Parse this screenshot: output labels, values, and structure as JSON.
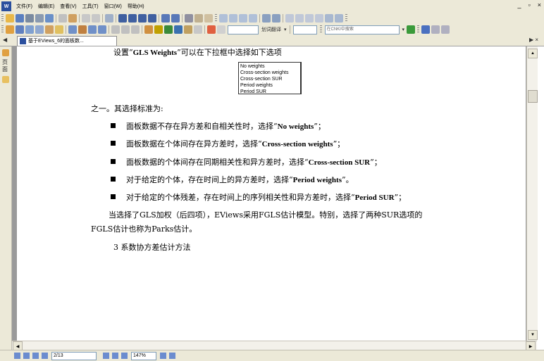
{
  "menubar": {
    "app_icon": "W",
    "items": [
      "文件(F)",
      "编辑(E)",
      "查看(V)",
      "工具(T)",
      "窗口(W)",
      "帮助(H)"
    ],
    "controls": [
      "_",
      "▫",
      "×"
    ]
  },
  "toolbar2": {
    "zoom_select": "划词翻译",
    "search_placeholder": "在CNKI中搜索"
  },
  "tab": {
    "title": "基于EViews_6的面板数...",
    "nav_left": "◀",
    "nav_right": "▶ ×"
  },
  "left_panel": {
    "label": "页面"
  },
  "document": {
    "line1_prefix": "设置“",
    "line1_bold": "GLS Weights",
    "line1_suffix": "”可以在下拉框中选择如下选项",
    "listbox_options": [
      "No weights",
      "Cross-section weights",
      "Cross-section SUR",
      "Period weights",
      "Period SUR"
    ],
    "para1": "之一。其选择标准为:",
    "bullets": [
      {
        "text": "面板数据不存在异方差和自相关性时，选择“",
        "bold": "No weights",
        "tail": "”；"
      },
      {
        "text": "面板数据在个体间存在异方差时，选择“",
        "bold": "Cross-section weights",
        "tail": "”；"
      },
      {
        "text": "面板数据的个体间存在同期相关性和异方差时，选择“",
        "bold": "Cross-section SUR",
        "tail": "”；"
      },
      {
        "text": "对于给定的个体，存在时间上的异方差时，选择“",
        "bold": "Period weights",
        "tail": "”。"
      },
      {
        "text": "对于给定的个体残差，存在时间上的序列相关性和异方差时，选择“",
        "bold": "Period SUR",
        "tail": "”；"
      }
    ],
    "para2_line1": "当选择了GLS加权（后四项），EViews采用FGLS估计模型。特别，选择了两种SUR选项的",
    "para2_line2": "FGLS估计也称为Parks估计。",
    "section_heading": "3  系数协方差估计方法"
  },
  "status": {
    "page": "2/13",
    "zoom": "147%"
  },
  "colors": {
    "chrome": "#ece9d8",
    "doc_bg": "#9a9a9a",
    "accent": "#2a4f9e"
  }
}
